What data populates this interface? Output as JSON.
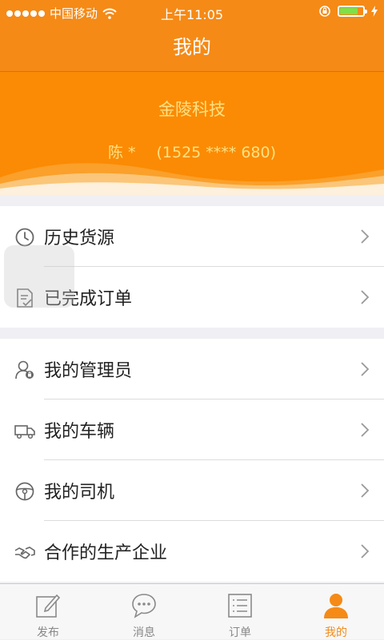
{
  "status_bar": {
    "carrier": "中国移动",
    "time": "上午11:05",
    "battery_level": 0.8
  },
  "nav": {
    "title": "我的"
  },
  "profile": {
    "company": "金陵科技",
    "name": "陈 *",
    "phone": "(1525 **** 680)"
  },
  "menu_group_1": [
    {
      "label": "历史货源",
      "icon": "clock-icon"
    },
    {
      "label": "已完成订单",
      "icon": "document-check-icon"
    }
  ],
  "menu_group_2": [
    {
      "label": "我的管理员",
      "icon": "admin-user-icon"
    },
    {
      "label": "我的车辆",
      "icon": "truck-icon"
    },
    {
      "label": "我的司机",
      "icon": "steering-wheel-icon"
    },
    {
      "label": "合作的生产企业",
      "icon": "handshake-icon"
    }
  ],
  "tabs": [
    {
      "label": "发布",
      "icon": "edit-icon",
      "active": false
    },
    {
      "label": "消息",
      "icon": "chat-icon",
      "active": false
    },
    {
      "label": "订单",
      "icon": "list-icon",
      "active": false
    },
    {
      "label": "我的",
      "icon": "person-icon",
      "active": true
    }
  ],
  "colors": {
    "primary": "#f58a16",
    "header_text": "#ffe182",
    "active_tab": "#f58a16"
  }
}
